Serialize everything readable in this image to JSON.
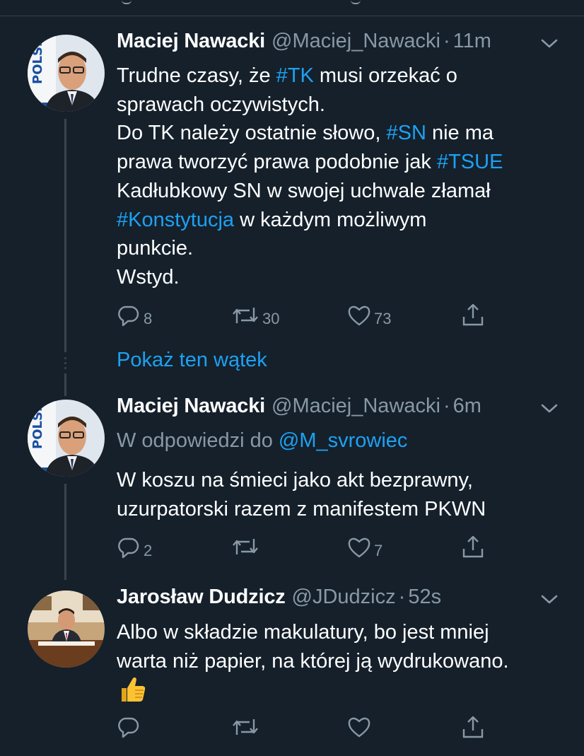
{
  "colors": {
    "background": "#15202b",
    "text": "#ffffff",
    "muted": "#8899a6",
    "accent": "#1da1f2",
    "divider": "#38444d"
  },
  "tweets": [
    {
      "name": "Maciej Nawacki",
      "handle": "@Maciej_Nawacki",
      "separator": "·",
      "time": "11m",
      "avatar_icon": "profile-photo-avatar",
      "lines": [
        [
          {
            "t": "Trudne czasy, że "
          },
          {
            "t": "#TK",
            "tag": true
          },
          {
            "t": " musi orzekać o"
          }
        ],
        [
          {
            "t": "sprawach oczywistych."
          }
        ],
        [
          {
            "t": "Do TK należy ostatnie słowo, "
          },
          {
            "t": "#SN",
            "tag": true
          },
          {
            "t": " nie ma"
          }
        ],
        [
          {
            "t": "prawa tworzyć prawa podobnie jak "
          },
          {
            "t": "#TSUE",
            "tag": true
          }
        ],
        [
          {
            "t": "Kadłubkowy SN w swojej uchwale złamał"
          }
        ],
        [
          {
            "t": "#Konstytucja",
            "tag": true
          },
          {
            "t": " w każdym możliwym"
          }
        ],
        [
          {
            "t": "punkcie."
          }
        ],
        [
          {
            "t": "Wstyd."
          }
        ]
      ],
      "replies": "8",
      "retweets": "30",
      "likes": "73"
    },
    {
      "name": "Maciej Nawacki",
      "handle": "@Maciej_Nawacki",
      "separator": "·",
      "time": "6m",
      "avatar_icon": "profile-photo-avatar",
      "reply_prefix": "W odpowiedzi do ",
      "reply_to": "@M_svrowiec",
      "lines": [
        [
          {
            "t": "W koszu na śmieci jako akt bezprawny,"
          }
        ],
        [
          {
            "t": "uzurpatorski razem z manifestem PKWN"
          }
        ]
      ],
      "replies": "2",
      "retweets": "",
      "likes": "7"
    },
    {
      "name": "Jarosław Dudzicz",
      "handle": "@JDudzicz",
      "separator": "·",
      "time": "52s",
      "avatar_icon": "profile-photo-avatar",
      "lines": [
        [
          {
            "t": "Albo w składzie makulatury, bo jest mniej"
          }
        ],
        [
          {
            "t": "warta niż papier, na której ją wydrukowano."
          }
        ]
      ],
      "emoji_icon": "thumbs-up-emoji",
      "replies": "",
      "retweets": "",
      "likes": ""
    }
  ],
  "show_thread": "Pokaż ten wątek",
  "action_icons": [
    "reply-icon",
    "retweet-icon",
    "like-icon",
    "share-icon"
  ],
  "avatar_badge_text": "POLSKA"
}
